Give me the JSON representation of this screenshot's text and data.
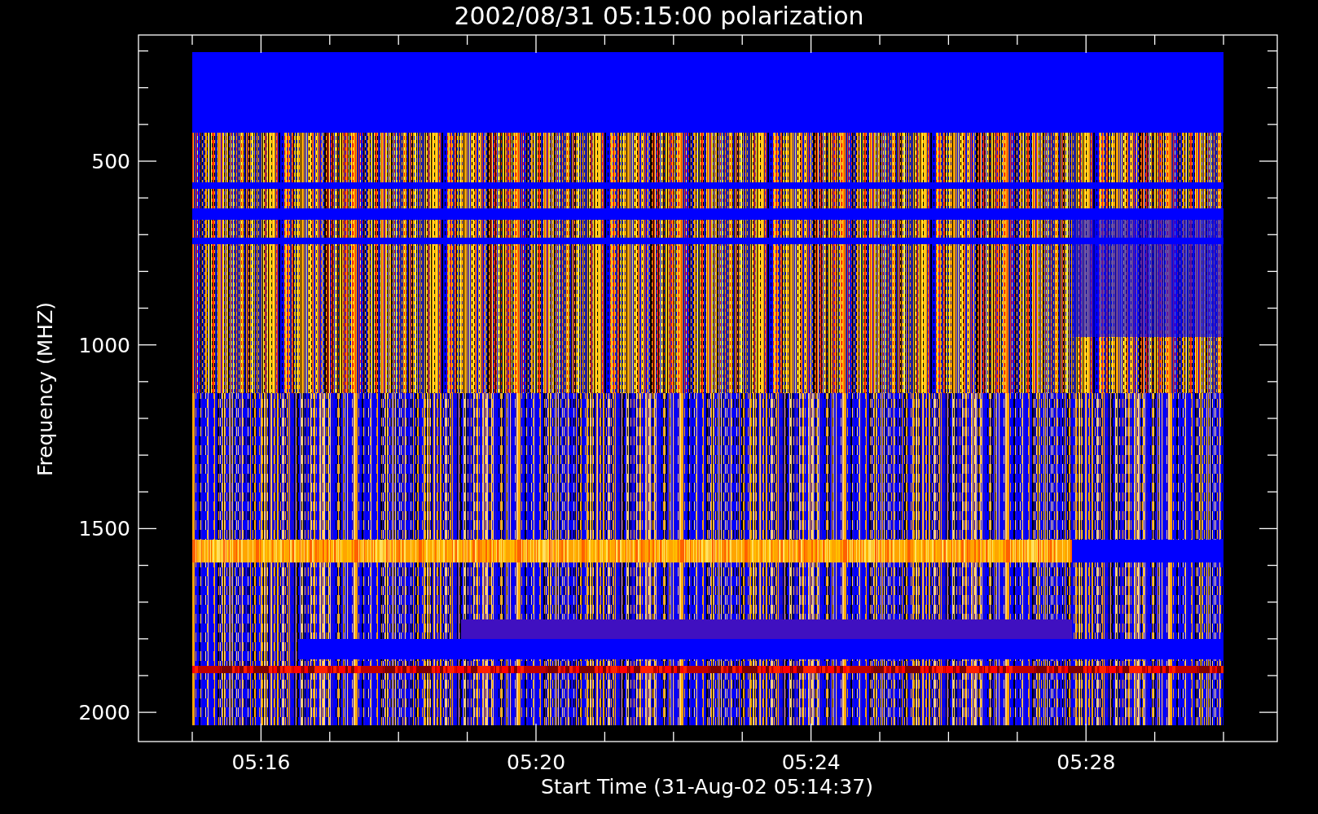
{
  "title": "2002/08/31 05:15:00 polarization",
  "y_axis": {
    "label": "Frequency (MHZ)",
    "tick_labels": [
      "500",
      "1000",
      "1500",
      "2000"
    ]
  },
  "x_axis": {
    "label": "Start Time (31-Aug-02 05:14:37)",
    "tick_labels": [
      "05:16",
      "05:20",
      "05:24",
      "05:28"
    ]
  }
}
